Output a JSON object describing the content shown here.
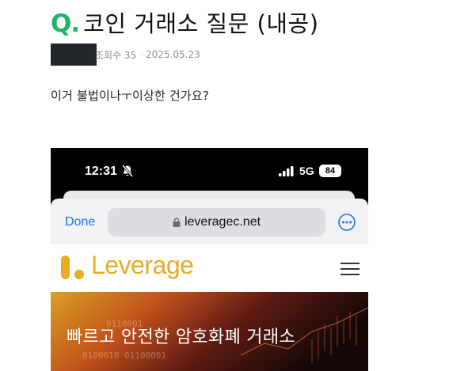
{
  "question": {
    "mark": "Q",
    "title": "코인 거래소 질문 (내공)",
    "views_label": "조회수 35",
    "date": "2025.05.23",
    "body": "이거 불법이나ㅜ이상한 건가요?"
  },
  "screenshot": {
    "status_bar": {
      "time": "12:31",
      "network": "5G",
      "battery": "84"
    },
    "browser": {
      "done_label": "Done",
      "url": "leveragec.net"
    },
    "site": {
      "logo_text": "Leverage",
      "hero_text": "빠르고 안전한 암호화폐 거래소"
    }
  },
  "colors": {
    "accent_green": "#1fb46a",
    "safari_blue": "#1a73e8",
    "logo_yellow": "#e8ab22"
  },
  "icons": [
    "q-mark-icon",
    "bell-slash-icon",
    "signal-icon",
    "battery-icon",
    "lock-icon",
    "more-icon",
    "leverage-logo-icon",
    "menu-icon"
  ]
}
